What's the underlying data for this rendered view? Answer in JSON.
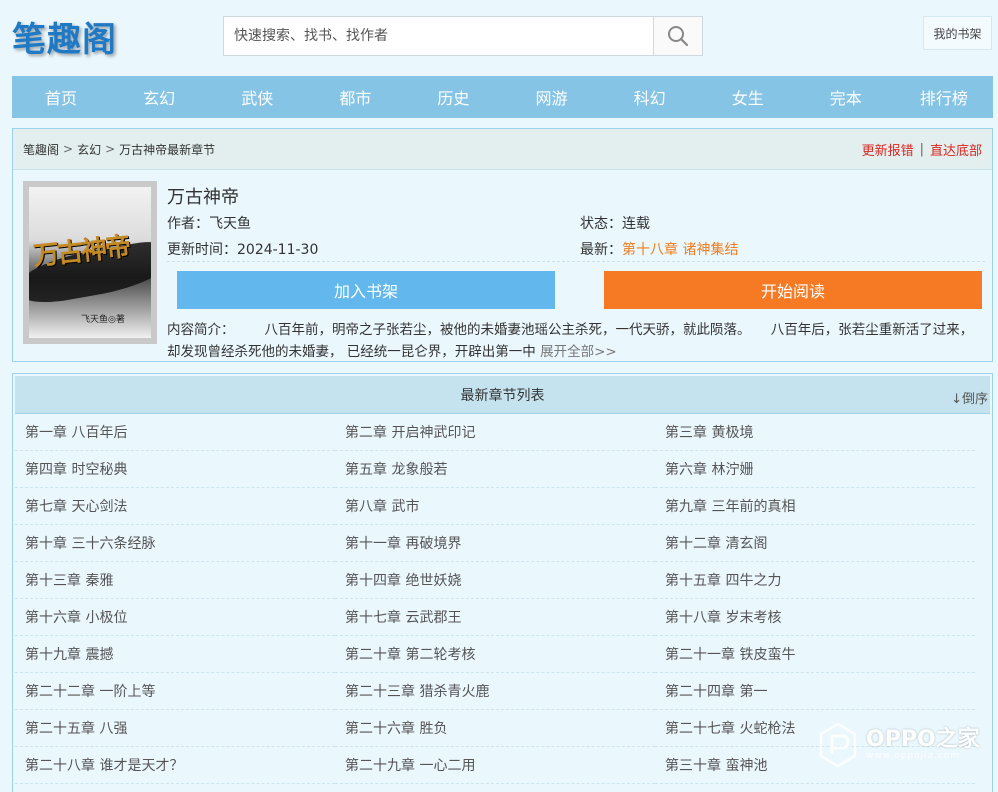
{
  "site": {
    "logo": "笔趣阁"
  },
  "search": {
    "placeholder": "快速搜索、找书、找作者"
  },
  "header": {
    "bookshelf_label": "我的书架"
  },
  "nav": {
    "items": [
      "首页",
      "玄幻",
      "武侠",
      "都市",
      "历史",
      "网游",
      "科幻",
      "女生",
      "完本",
      "排行榜"
    ]
  },
  "breadcrumb": {
    "home": "笔趣阁",
    "category": "玄幻",
    "current": "万古神帝最新章节",
    "separator": ">"
  },
  "actions": {
    "report": "更新报错",
    "divider": "|",
    "to_bottom": "直达底部"
  },
  "book": {
    "title": "万古神帝",
    "cover_title": "万古神帝",
    "cover_author": "飞天鱼◎著",
    "author_label": "作者：",
    "author": "飞天鱼",
    "status_label": "状态：",
    "status": "连载",
    "updated_label": "更新时间：",
    "updated": "2024-11-30",
    "latest_label": "最新：",
    "latest": "第十八章 诸神集结",
    "add_button": "加入书架",
    "read_button": "开始阅读",
    "intro_label": "内容简介：",
    "intro_text": "八百年前，明帝之子张若尘，被他的未婚妻池瑶公主杀死，一代天骄，就此陨落。　　八百年后，张若尘重新活了过来，却发现曾经杀死他的未婚妻，  已经统一昆仑界，开辟出第一中",
    "intro_more": "展开全部>>"
  },
  "chapter_list": {
    "title": "最新章节列表",
    "sort_label": "↓倒序",
    "items": [
      "第一章 八百年后",
      "第二章 开启神武印记",
      "第三章 黄极境",
      "第四章 时空秘典",
      "第五章 龙象般若",
      "第六章 林泞姗",
      "第七章 天心剑法",
      "第八章 武市",
      "第九章 三年前的真相",
      "第十章 三十六条经脉",
      "第十一章 再破境界",
      "第十二章 清玄阁",
      "第十三章 秦雅",
      "第十四章 绝世妖娆",
      "第十五章 四牛之力",
      "第十六章 小极位",
      "第十七章 云武郡王",
      "第十八章 岁末考核",
      "第十九章 震撼",
      "第二十章 第二轮考核",
      "第二十一章 铁皮蛮牛",
      "第二十二章 一阶上等",
      "第二十三章 猎杀青火鹿",
      "第二十四章 第一",
      "第二十五章 八强",
      "第二十六章 胜负",
      "第二十七章 火蛇枪法",
      "第二十八章 谁才是天才？",
      "第二十九章 一心二用",
      "第三十章 蛮神池"
    ]
  },
  "watermark": {
    "brand": "OPPO之家",
    "url": "www.oppojia.com"
  },
  "colors": {
    "nav": "#86c4e5",
    "add_button": "#62b8ec",
    "read_button": "#f67a23",
    "latest": "#f07d1f",
    "action_link": "#d8261f"
  }
}
